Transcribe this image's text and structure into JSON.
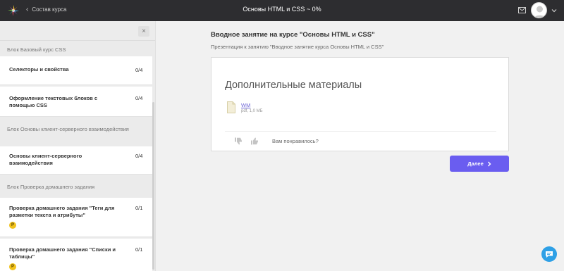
{
  "header": {
    "back_label": "Состав курса",
    "course_title": "Основы HTML и CSS ~ 0%"
  },
  "sidebar": {
    "close_label": "×",
    "blocks": [
      {
        "title": "Блок Базовый курс CSS",
        "lessons": [
          {
            "name": "Селекторы и свойства",
            "count": "0/4"
          },
          {
            "name": "Оформление текстовых блоков с помощью CSS",
            "count": "0/4"
          }
        ]
      },
      {
        "title": "Блок Основы клиент-серверного взаимодействия",
        "lessons": [
          {
            "name": "Основы клиент-серверного взаимодействия",
            "count": "0/4"
          }
        ]
      },
      {
        "title": "Блок Проверка домашнего задания",
        "lessons": [
          {
            "name": "Проверка домашнего задания \"Теги для разметки текста и атрибуты\"",
            "count": "0/1",
            "badge": "Р"
          },
          {
            "name": "Проверка домашнего задания \"Списки и таблицы\"",
            "count": "0/1",
            "badge": "Р"
          }
        ]
      }
    ]
  },
  "main": {
    "title": "Вводное занятие на курсе \"Основы HTML и CSS\"",
    "subtitle": "Презентация к занятию \"Вводное занятие курса Основы HTML и CSS\"",
    "materials_heading": "Дополнительные материалы",
    "file": {
      "name": "WM",
      "meta": "pdf, 1,0 МБ"
    },
    "feedback_question": "Вам понравилось?",
    "next_label": "Далее"
  },
  "colors": {
    "topbar": "#2d2d30",
    "accent": "#6a5df0",
    "chat": "#2ea0e6",
    "badge": "#f1c21b"
  },
  "icons": [
    "logo-icon",
    "chevron-left-icon",
    "mail-icon",
    "avatar",
    "chevron-down-icon",
    "close-icon",
    "file-icon",
    "thumbs-down-icon",
    "thumbs-up-icon",
    "chevron-right-icon",
    "chat-icon"
  ]
}
